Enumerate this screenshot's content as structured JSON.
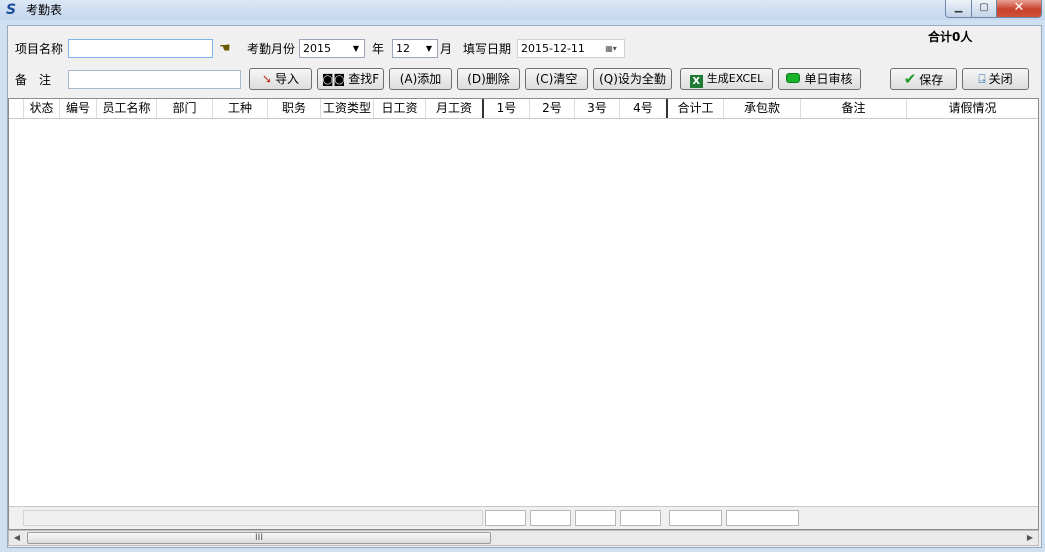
{
  "window": {
    "title": "考勤表",
    "app_icon": "S"
  },
  "form": {
    "project_label": "项目名称",
    "project_value": "",
    "month_label": "考勤月份",
    "year_value": "2015",
    "year_unit": "年",
    "month_value": "12",
    "month_unit": "月",
    "fill_date_label": "填写日期",
    "fill_date_value": "2015-12-11",
    "remark_label": "备　注",
    "remark_value": ""
  },
  "summary": {
    "total_text": "合计0人"
  },
  "toolbar": {
    "import": "导入",
    "search": "查找F",
    "add": "(A)添加",
    "delete": "(D)删除",
    "clear": "(C)清空",
    "set_full": "(Q)设为全勤",
    "export_excel": "生成EXCEL",
    "daily_review": "单日审核",
    "save": "保存",
    "close": "关闭"
  },
  "table": {
    "columns": [
      "状态",
      "编号",
      "员工名称",
      "部门",
      "工种",
      "职务",
      "工资类型",
      "日工资",
      "月工资",
      "1号",
      "2号",
      "3号",
      "4号",
      "合计工",
      "承包款",
      "备注",
      "请假情况"
    ],
    "rows": []
  },
  "scrollbar": {
    "thumb_grip": "III"
  },
  "icons": {
    "app": "app-logo-icon",
    "project_lookup": "pointing-hand-icon",
    "calendar": "calendar-icon",
    "import": "import-icon",
    "search": "binoculars-icon",
    "excel": "excel-icon",
    "review": "green-led-icon",
    "save": "checkmark-icon",
    "close": "exit-door-icon"
  },
  "colors": {
    "title_bar": "#c4d7ee",
    "close_button": "#c8412c",
    "client_bg": "#f0f0f0"
  }
}
